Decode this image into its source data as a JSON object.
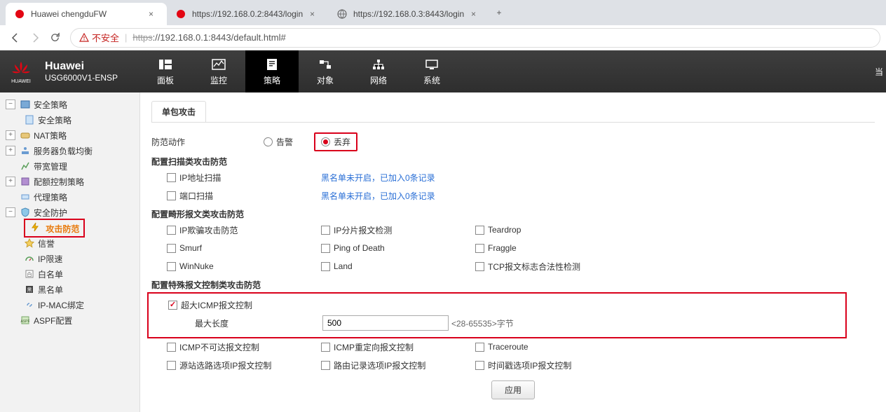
{
  "browser": {
    "tabs": [
      {
        "title": "Huawei chengduFW",
        "favicon": "huawei"
      },
      {
        "title": "https://192.168.0.2:8443/login",
        "favicon": "huawei"
      },
      {
        "title": "https://192.168.0.3:8443/login",
        "favicon": "globe"
      }
    ],
    "url_insecure_label": "不安全",
    "url_scheme_struck": "https",
    "url_rest": "://192.168.0.1:8443/default.html#"
  },
  "header": {
    "brand": "Huawei",
    "model": "USG6000V1-ENSP",
    "nav": [
      "面板",
      "监控",
      "策略",
      "对象",
      "网络",
      "系统"
    ],
    "active_index": 2,
    "corner": "当"
  },
  "sidebar": {
    "items": [
      {
        "label": "安全策略",
        "toggle": "-",
        "children": [
          {
            "label": "安全策略"
          }
        ]
      },
      {
        "label": "NAT策略",
        "toggle": "+"
      },
      {
        "label": "服务器负载均衡",
        "toggle": "+"
      },
      {
        "label": "带宽管理",
        "toggle": ""
      },
      {
        "label": "配额控制策略",
        "toggle": "+"
      },
      {
        "label": "代理策略",
        "toggle": ""
      },
      {
        "label": "安全防护",
        "toggle": "-",
        "children": [
          {
            "label": "攻击防范",
            "hot": true
          },
          {
            "label": "信誉"
          },
          {
            "label": "IP限速"
          },
          {
            "label": "白名单"
          },
          {
            "label": "黑名单"
          },
          {
            "label": "IP-MAC绑定"
          }
        ]
      },
      {
        "label": "ASPF配置",
        "toggle": ""
      }
    ]
  },
  "main": {
    "page_tab": "单包攻击",
    "action_label": "防范动作",
    "radio_warn": "告警",
    "radio_drop": "丢弃",
    "sec_scan": "配置扫描类攻击防范",
    "scan_ip": "IP地址扫描",
    "scan_port": "端口扫描",
    "scan_status": "黑名单未开启，已加入0条记录",
    "sec_malformed": "配置畸形报文类攻击防范",
    "mal": {
      "ip_spoof": "IP欺骗攻击防范",
      "ip_frag": "IP分片报文检测",
      "teardrop": "Teardrop",
      "smurf": "Smurf",
      "pod": "Ping of Death",
      "fraggle": "Fraggle",
      "winnuke": "WinNuke",
      "land": "Land",
      "tcpflag": "TCP报文标志合法性检测"
    },
    "sec_special": "配置特殊报文控制类攻击防范",
    "spec": {
      "big_icmp": "超大ICMP报文控制",
      "maxlen_label": "最大长度",
      "maxlen_value": "500",
      "maxlen_hint": "<28-65535>字节",
      "icmp_unreach": "ICMP不可达报文控制",
      "icmp_redirect": "ICMP重定向报文控制",
      "traceroute": "Traceroute",
      "src_route": "源站选路选项IP报文控制",
      "record_route": "路由记录选项IP报文控制",
      "timestamp": "时间戳选项IP报文控制"
    },
    "apply": "应用"
  }
}
